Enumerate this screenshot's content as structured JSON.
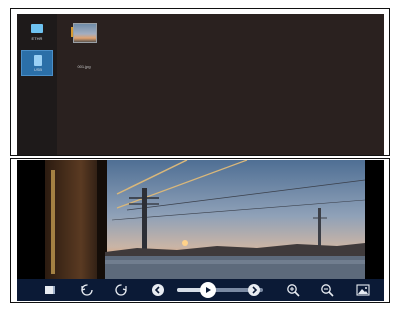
{
  "file_browser": {
    "nav": [
      {
        "label": "ETHR",
        "icon": "folder-icon",
        "selected": false
      },
      {
        "label": "USB",
        "icon": "usb-drive-icon",
        "selected": true
      }
    ],
    "files": [
      {
        "name": "001.jpg",
        "icon": "image-thumbnail"
      }
    ]
  },
  "viewer": {
    "image_icon": "sunset-photo",
    "controls": [
      {
        "id": "stop",
        "icon": "stop-icon"
      },
      {
        "id": "rotate-left",
        "icon": "rotate-left-icon"
      },
      {
        "id": "rotate-right",
        "icon": "rotate-right-icon"
      },
      {
        "id": "previous",
        "icon": "previous-icon"
      },
      {
        "id": "play",
        "icon": "play-icon"
      },
      {
        "id": "next",
        "icon": "next-icon"
      },
      {
        "id": "zoom-in",
        "icon": "zoom-in-icon"
      },
      {
        "id": "zoom-out",
        "icon": "zoom-out-icon"
      },
      {
        "id": "info",
        "icon": "image-info-icon"
      }
    ],
    "slideshow_progress": 0.35
  },
  "colors": {
    "panel_bg": "#2a211f",
    "nav_selected": "#2b6fa8",
    "toolbar_bg": "#0b1a36"
  }
}
